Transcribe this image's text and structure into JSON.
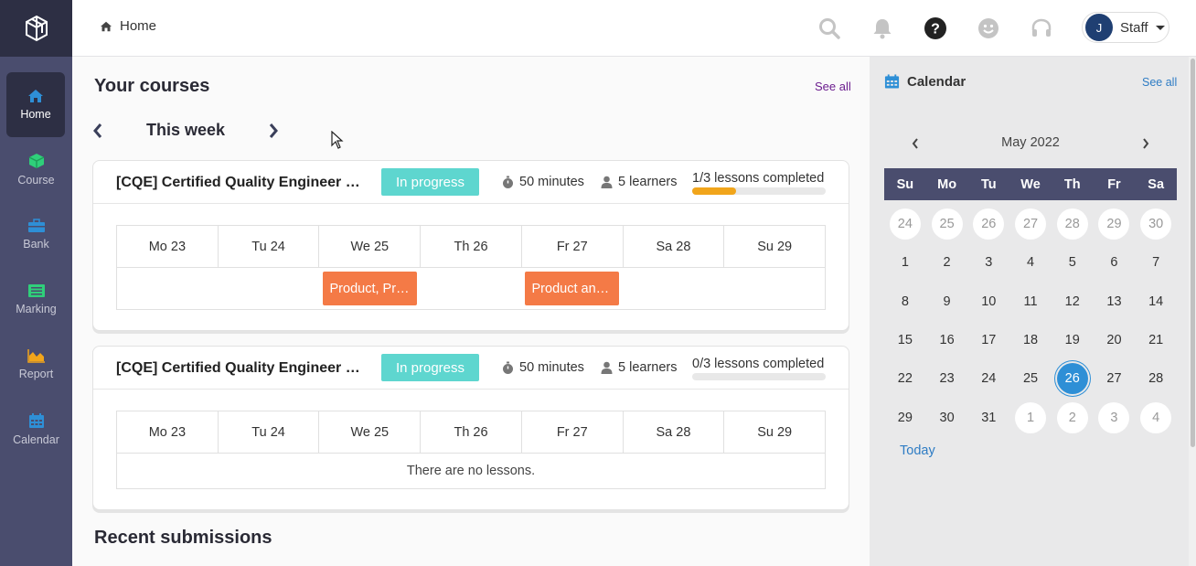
{
  "header": {
    "breadcrumb": "Home",
    "user_initial": "J",
    "user_role": "Staff"
  },
  "sidebar": {
    "items": [
      {
        "label": "Home",
        "icon": "home-icon",
        "color": "#2e8fd6"
      },
      {
        "label": "Course",
        "icon": "cube-icon",
        "color": "#2fcf7a"
      },
      {
        "label": "Bank",
        "icon": "toolbox-icon",
        "color": "#2e8fd6"
      },
      {
        "label": "Marking",
        "icon": "list-icon",
        "color": "#2fcf7a"
      },
      {
        "label": "Report",
        "icon": "chart-area-icon",
        "color": "#f1a51b"
      },
      {
        "label": "Calendar",
        "icon": "calendar-icon",
        "color": "#2e8fd6"
      }
    ]
  },
  "courses": {
    "title": "Your courses",
    "see_all": "See all",
    "week_label": "This week",
    "days": [
      "Mo 23",
      "Tu 24",
      "We 25",
      "Th 26",
      "Fr 27",
      "Sa 28",
      "Su 29"
    ],
    "cards": [
      {
        "title": "[CQE] Certified Quality Engineer (CQE) Training",
        "status": "In progress",
        "duration": "50 minutes",
        "learners": "5 learners",
        "progress_label": "1/3 lessons completed",
        "progress": 0.33,
        "lessons": [
          {
            "day_index": 2,
            "label": "Product, Process and Service Design"
          },
          {
            "day_index": 4,
            "label": "Product and Process Control"
          }
        ]
      },
      {
        "title": "[CQE] Certified Quality Engineer (CQE) Training",
        "status": "In progress",
        "duration": "50 minutes",
        "learners": "5 learners",
        "progress_label": "0/3 lessons completed",
        "progress": 0,
        "empty_text": "There are no lessons."
      }
    ]
  },
  "submissions": {
    "title": "Recent submissions"
  },
  "calendar": {
    "title": "Calendar",
    "see_all": "See all",
    "month": "May 2022",
    "weekdays": [
      "Su",
      "Mo",
      "Tu",
      "We",
      "Th",
      "Fr",
      "Sa"
    ],
    "weeks": [
      [
        "24",
        "25",
        "26",
        "27",
        "28",
        "29",
        "30"
      ],
      [
        "1",
        "2",
        "3",
        "4",
        "5",
        "6",
        "7"
      ],
      [
        "8",
        "9",
        "10",
        "11",
        "12",
        "13",
        "14"
      ],
      [
        "15",
        "16",
        "17",
        "18",
        "19",
        "20",
        "21"
      ],
      [
        "22",
        "23",
        "24",
        "25",
        "26",
        "27",
        "28"
      ],
      [
        "29",
        "30",
        "31",
        "1",
        "2",
        "3",
        "4"
      ]
    ],
    "today": "26",
    "today_link": "Today"
  },
  "colors": {
    "accent": "#2e8fd6",
    "badge": "#5ed6cf",
    "lesson": "#f47a46",
    "progress": "#f1a51b",
    "sidebar": "#4a4d6e"
  }
}
